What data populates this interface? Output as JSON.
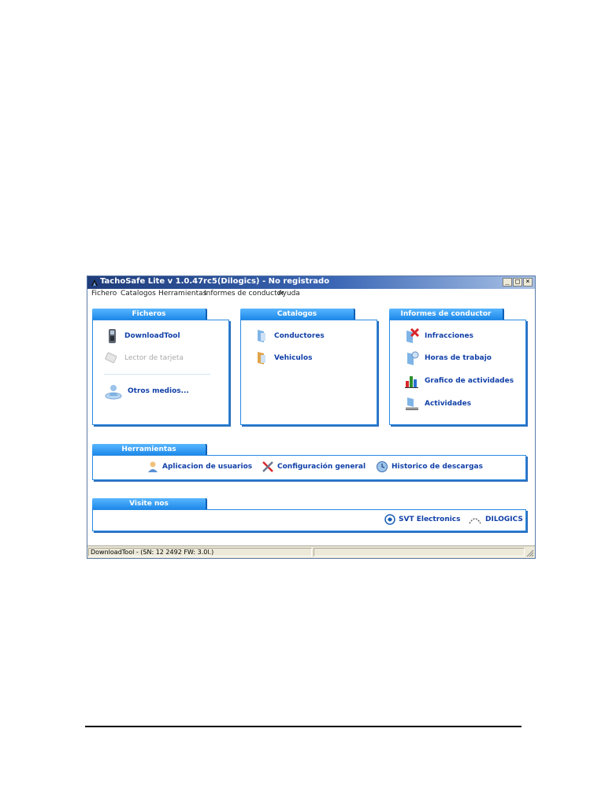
{
  "window": {
    "title": "TachoSafe Lite v 1.0.47rc5(Dilogics) - No registrado",
    "buttons": {
      "minimize": "_",
      "maximize": "□",
      "close": "×"
    }
  },
  "menu": {
    "items": [
      {
        "label": "Fichero"
      },
      {
        "label": "Catalogos"
      },
      {
        "label": "Herramientas"
      },
      {
        "label": "Informes de conductor"
      },
      {
        "label": "Ayuda"
      }
    ]
  },
  "panels": {
    "ficheros": {
      "title": "Ficheros",
      "items": [
        {
          "label": "DownloadTool",
          "icon": "card-reader-icon",
          "enabled": true
        },
        {
          "label": "Lector de tarjeta",
          "icon": "card-icon",
          "enabled": false
        },
        {
          "label": "Otros medios...",
          "icon": "disk-user-icon",
          "enabled": true
        }
      ]
    },
    "catalogos": {
      "title": "Catalogos",
      "items": [
        {
          "label": "Conductores",
          "icon": "driver-icon"
        },
        {
          "label": "Vehiculos",
          "icon": "vehicle-icon"
        }
      ]
    },
    "informes": {
      "title": "Informes de conductor",
      "items": [
        {
          "label": "Infracciones",
          "icon": "infraction-icon"
        },
        {
          "label": "Horas de trabajo",
          "icon": "work-hours-icon"
        },
        {
          "label": "Grafico de actividades",
          "icon": "bar-chart-icon"
        },
        {
          "label": "Actividades",
          "icon": "activities-icon"
        }
      ]
    },
    "herramientas": {
      "title": "Herramientas",
      "items": [
        {
          "label": "Aplicacion de usuarios",
          "icon": "user-icon"
        },
        {
          "label": "Configuración general",
          "icon": "tools-icon"
        },
        {
          "label": "Historico de descargas",
          "icon": "history-icon"
        }
      ]
    },
    "visite": {
      "title": "Visite nos",
      "items": [
        {
          "label": "SVT Electronics",
          "icon": "svt-logo-icon"
        },
        {
          "label": "DILOGICS",
          "icon": "dilogics-logo-icon"
        }
      ]
    }
  },
  "statusbar": {
    "text": "DownloadTool - (SN: 12 2492 FW: 3.0l.)"
  },
  "colors": {
    "tab": "#1a86e8",
    "border": "#2a8ae0",
    "link": "#1140a8",
    "title": "#1f3c7a"
  }
}
